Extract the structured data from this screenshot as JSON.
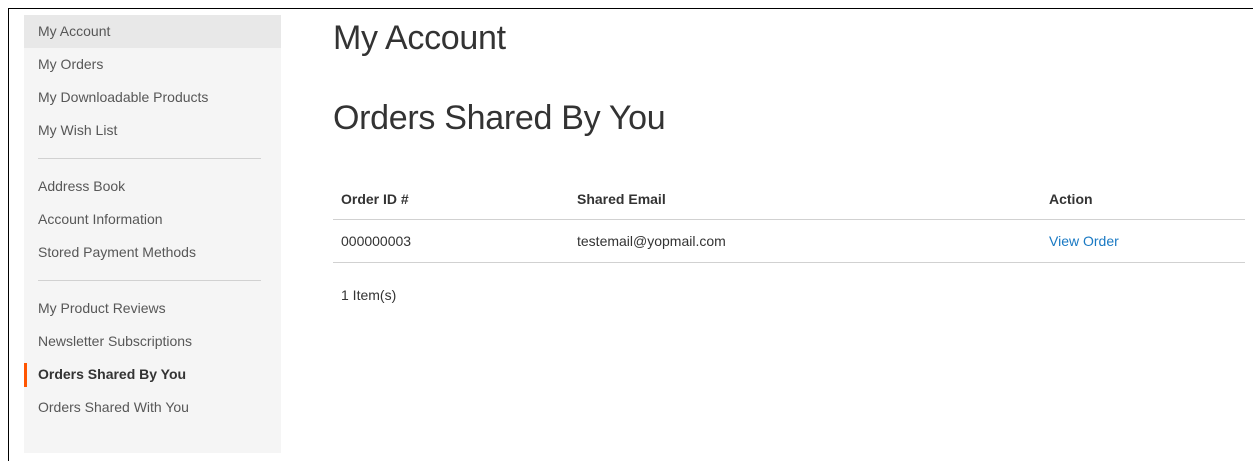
{
  "sidebar": {
    "groups": [
      {
        "items": [
          {
            "label": "My Account"
          },
          {
            "label": "My Orders"
          },
          {
            "label": "My Downloadable Products"
          },
          {
            "label": "My Wish List"
          }
        ]
      },
      {
        "items": [
          {
            "label": "Address Book"
          },
          {
            "label": "Account Information"
          },
          {
            "label": "Stored Payment Methods"
          }
        ]
      },
      {
        "items": [
          {
            "label": "My Product Reviews"
          },
          {
            "label": "Newsletter Subscriptions"
          },
          {
            "label": "Orders Shared By You"
          },
          {
            "label": "Orders Shared With You"
          }
        ]
      }
    ],
    "current_item": "Orders Shared By You",
    "accent_color": "#ff5501"
  },
  "main": {
    "page_title": "My Account",
    "section_title": "Orders Shared By You",
    "table": {
      "headers": {
        "order_id": "Order ID #",
        "shared_email": "Shared Email",
        "action": "Action"
      },
      "rows": [
        {
          "order_id": "000000003",
          "shared_email": "testemail@yopmail.com",
          "action": "View Order"
        }
      ]
    },
    "item_count": "1 Item(s)",
    "link_color": "#1979c3"
  }
}
